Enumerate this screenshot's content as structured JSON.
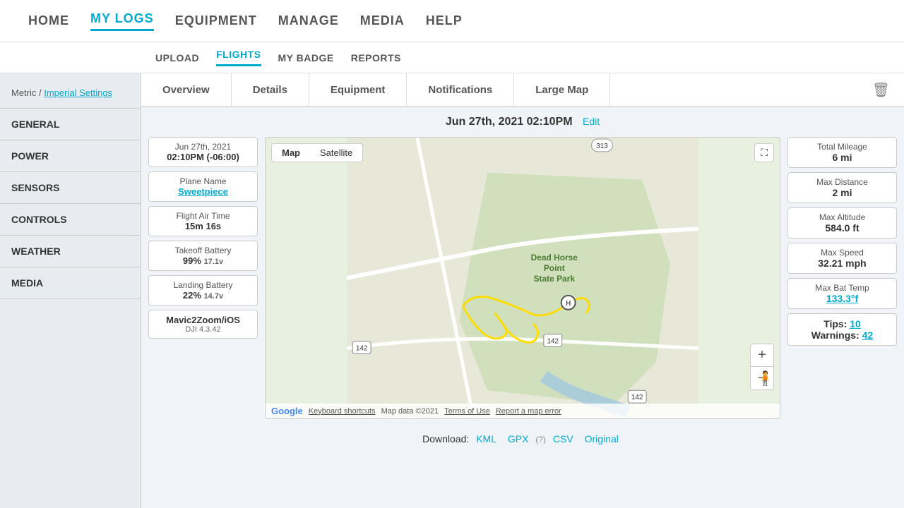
{
  "nav": {
    "items": [
      {
        "label": "HOME",
        "active": false
      },
      {
        "label": "MY LOGS",
        "active": true
      },
      {
        "label": "EQUIPMENT",
        "active": false
      },
      {
        "label": "MANAGE",
        "active": false
      },
      {
        "label": "MEDIA",
        "active": false
      },
      {
        "label": "HELP",
        "active": false
      }
    ]
  },
  "subnav": {
    "items": [
      {
        "label": "UPLOAD",
        "active": false
      },
      {
        "label": "FLIGHTS",
        "active": true
      },
      {
        "label": "MY BADGE",
        "active": false
      },
      {
        "label": "REPORTS",
        "active": false
      }
    ]
  },
  "sidebar": {
    "settings_prefix": "Metric / ",
    "settings_link": "Imperial Settings",
    "sections": [
      "GENERAL",
      "POWER",
      "SENSORS",
      "CONTROLS",
      "WEATHER",
      "MEDIA"
    ]
  },
  "tabs": {
    "items": [
      "Overview",
      "Details",
      "Equipment",
      "Notifications",
      "Large Map"
    ],
    "trash_icon": "🗑"
  },
  "flight": {
    "date_label": "Jun 27th, 2021 02:10PM",
    "edit_label": "Edit"
  },
  "left_cards": [
    {
      "label": "Jun 27th, 2021",
      "value": "02:10PM (-06:00)"
    },
    {
      "label": "Plane Name",
      "value": "Sweetpiece",
      "link": true
    },
    {
      "label": "Flight Air Time",
      "value": "15m 16s"
    },
    {
      "label": "Takeoff Battery",
      "value": "99%",
      "sub": "17.1v"
    },
    {
      "label": "Landing Battery",
      "value": "22%",
      "sub": "14.7v"
    },
    {
      "label": "Device",
      "value": "Mavic2Zoom/iOS",
      "sub": "DJI 4.3.42"
    }
  ],
  "map": {
    "tab_map": "Map",
    "tab_satellite": "Satellite",
    "fullscreen_icon": "⛶",
    "zoom_in": "+",
    "zoom_out": "−",
    "keyboard_shortcuts": "Keyboard shortcuts",
    "map_data": "Map data ©2021",
    "terms": "Terms of Use",
    "report": "Report a map error",
    "park_label": "Dead Horse Point State Park",
    "road_142": "142",
    "road_313": "313"
  },
  "right_stats": [
    {
      "label": "Total Mileage",
      "value": "6 mi"
    },
    {
      "label": "Max Distance",
      "value": "2 mi"
    },
    {
      "label": "Max Altitude",
      "value": "584.0 ft"
    },
    {
      "label": "Max Speed",
      "value": "32.21 mph"
    },
    {
      "label": "Max Bat Temp",
      "value": "133.3°f",
      "link": true
    },
    {
      "label": "Tips:",
      "value": "10",
      "link": true,
      "extra_label": "Warnings:",
      "extra_value": "42",
      "extra_link": true
    }
  ],
  "download": {
    "label": "Download:",
    "links": [
      "KML",
      "GPX",
      "CSV",
      "Original"
    ],
    "gpx_question": "(?)"
  }
}
